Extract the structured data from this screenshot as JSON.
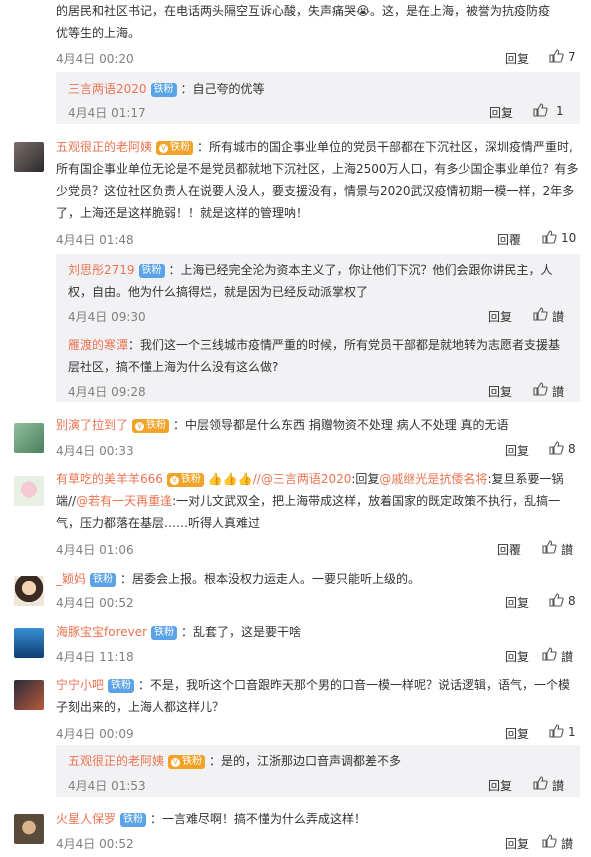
{
  "top": {
    "line1": "的居民和社区书记，在电话两头隔空互诉心酸，失声痛哭😭。这，是在上海，被誉为抗疫防疫",
    "line2": "优等生的上海。",
    "time": "4月4日 00:20",
    "reply": "回复",
    "likes": "7"
  },
  "sub0": {
    "user": "三言两语2020",
    "badge": "铁粉",
    "text": "：自己夸的优等",
    "time": "4月4日 01:17",
    "reply": "回复",
    "likes": "1"
  },
  "c1": {
    "user": "五观很正的老阿姨",
    "badge": "铁粉",
    "line1": "：所有城市的国企事业单位的党员干部都在下沉社区，深圳疫情严重时,",
    "line2": "所有国企事业单位无论是不是党员都就地下沉社区，上海2500万人口，有多少国企事业单位？有多",
    "line3": "少党员？这位社区负责人在说要人没人，要支援没有，情景与2020武汉疫情初期一模一样，2年多",
    "line4": "了，上海还是这样脆弱！！就是这样的管理呐！",
    "time": "4月4日 01:48",
    "reply": "回覆",
    "likes": "10"
  },
  "c1s1": {
    "user": "刘思彤2719",
    "badge": "铁粉",
    "line1": "：上海已经完全沦为资本主义了，你让他们下沉？他们会跟你讲民主，人",
    "line2": "权，自由。他为什么搞得烂，就是因为已经反动派掌权了",
    "time": "4月4日 09:30",
    "reply": "回复",
    "likes": "讃"
  },
  "c1s2": {
    "user": "雁渡的寒潭",
    "text": "：我们这一个三线城市疫情严重的时候，所有党员干部都是就地转为志愿者支援基",
    "line2": "层社区，搞不懂上海为什么没有这么做?",
    "time": "4月4日 09:28",
    "reply": "回复",
    "likes": "讃"
  },
  "c2": {
    "user": "别演了拉到了",
    "badge": "铁粉",
    "text": "：中层领导都是什么东西 捐赠物资不处理 病人不处理 真的无语",
    "time": "4月4日 00:33",
    "reply": "回复",
    "likes": "8"
  },
  "c3": {
    "user": "有草吃的美羊羊666",
    "badge": "铁粉",
    "emoji": "👍👍👍",
    "m1": "//@三言两语2020",
    "t1": ":回复",
    "m2": "@戚继光是抗倭名将",
    "t2": ":复旦系要一锅",
    "line2a": "端//",
    "m3": "@若有一天再重逢",
    "line2b": ":一对儿文武双全，把上海带成这样，放着国家的既定政策不执行，乱搞一",
    "line3": "气，压力都落在基层……听得人真难过",
    "time": "4月4日 01:06",
    "reply": "回覆",
    "likes": "讃"
  },
  "c4": {
    "user": "_颖妈",
    "badge": "铁粉",
    "text": "：居委会上报。根本没权力运走人。一要只能听上级的。",
    "time": "4月4日 00:52",
    "reply": "回复",
    "likes": "8"
  },
  "c5": {
    "user": "海豚宝宝forever",
    "badge": "铁粉",
    "text": "：乱套了，这是要干啥",
    "time": "4月4日 11:18",
    "reply": "回复",
    "likes": "讃"
  },
  "c6": {
    "user": "宁宁小吧",
    "badge": "铁粉",
    "line1": "：不是，我听这个口音跟昨天那个男的口音一模一样呢？说话逻辑，语气，一个模",
    "line2": "子刻出来的，上海人都这样儿？",
    "time": "4月4日 00:09",
    "reply": "回复",
    "likes": "1"
  },
  "c6s1": {
    "user": "五观很正的老阿姨",
    "badge": "铁粉",
    "text": "：是的，江浙那边口音声调都差不多",
    "time": "4月4日 01:53",
    "reply": "回复",
    "likes": "讃"
  },
  "c7": {
    "user": "火星人保罗",
    "badge": "铁粉",
    "text": "：一言难尽啊！搞不懂为什么弄成这样！",
    "time": "4月4日 00:52",
    "reply": "回复",
    "likes": "讃"
  },
  "colors": {
    "accent": "#eb7350",
    "badge_blue": "#5aa3e6",
    "sub_bg": "#f2f2f5"
  }
}
